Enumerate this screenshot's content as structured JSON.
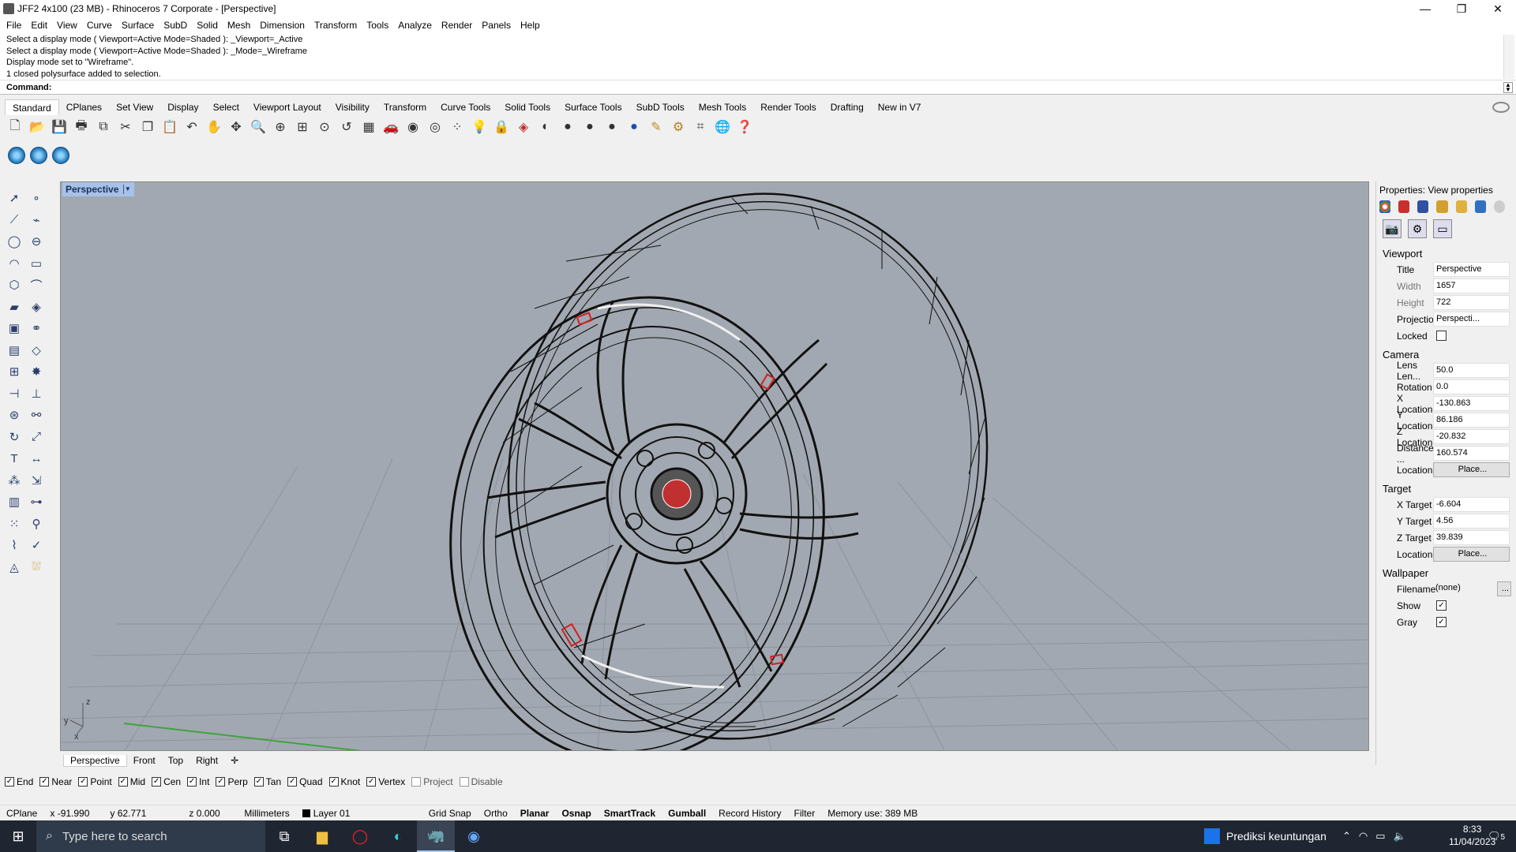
{
  "window": {
    "title": "JFF2 4x100 (23 MB) - Rhinoceros 7 Corporate - [Perspective]",
    "controls": [
      "—",
      "❐",
      "✕"
    ]
  },
  "menu": [
    "File",
    "Edit",
    "View",
    "Curve",
    "Surface",
    "SubD",
    "Solid",
    "Mesh",
    "Dimension",
    "Transform",
    "Tools",
    "Analyze",
    "Render",
    "Panels",
    "Help"
  ],
  "command_history": [
    "Select a display mode ( Viewport=Active  Mode=Shaded ): _Viewport=_Active",
    "Select a display mode ( Viewport=Active  Mode=Shaded ): _Mode=_Wireframe",
    "Display mode set to \"Wireframe\".",
    "1 closed polysurface added to selection."
  ],
  "command_prompt": "Command:",
  "toolbar_tabs": [
    "Standard",
    "CPlanes",
    "Set View",
    "Display",
    "Select",
    "Viewport Layout",
    "Visibility",
    "Transform",
    "Curve Tools",
    "Solid Tools",
    "Surface Tools",
    "SubD Tools",
    "Mesh Tools",
    "Render Tools",
    "Drafting",
    "New in V7"
  ],
  "toolbar_icons": [
    "new-file-icon",
    "open-icon",
    "save-icon",
    "print-icon",
    "import-icon",
    "cut-icon",
    "copy-icon",
    "paste-icon",
    "undo-icon",
    "pan-icon",
    "rotate-view-icon",
    "zoom-icon",
    "zoom-window-icon",
    "zoom-extents-icon",
    "zoom-selected-icon",
    "undo-view-icon",
    "four-view-icon",
    "car-icon",
    "eye-icon",
    "target-icon",
    "points-icon",
    "light-icon",
    "lock-icon",
    "layer-icon",
    "color-wheel-icon",
    "sphere-icon",
    "material-sphere-icon",
    "render-sphere-icon",
    "sphere-blue-icon",
    "pencil-icon",
    "gear-icon",
    "grid-icon",
    "globe-icon",
    "help-icon"
  ],
  "viewport": {
    "label": "Perspective",
    "axis_labels": {
      "z": "z",
      "y": "y",
      "x": "x"
    }
  },
  "viewport_tabs": [
    "Perspective",
    "Front",
    "Top",
    "Right"
  ],
  "osnaps": [
    {
      "label": "End",
      "checked": true
    },
    {
      "label": "Near",
      "checked": true
    },
    {
      "label": "Point",
      "checked": true
    },
    {
      "label": "Mid",
      "checked": true
    },
    {
      "label": "Cen",
      "checked": true
    },
    {
      "label": "Int",
      "checked": true
    },
    {
      "label": "Perp",
      "checked": true
    },
    {
      "label": "Tan",
      "checked": true
    },
    {
      "label": "Quad",
      "checked": true
    },
    {
      "label": "Knot",
      "checked": true
    },
    {
      "label": "Vertex",
      "checked": true
    },
    {
      "label": "Project",
      "checked": false
    },
    {
      "label": "Disable",
      "checked": false
    }
  ],
  "status": {
    "cplane": "CPlane",
    "x": "x -91.990",
    "y": "y 62.771",
    "z": "z 0.000",
    "units": "Millimeters",
    "layer": "Layer 01",
    "grid_snap": "Grid Snap",
    "ortho": "Ortho",
    "planar": "Planar",
    "osnap": "Osnap",
    "smarttrack": "SmartTrack",
    "gumball": "Gumball",
    "record_history": "Record History",
    "filter": "Filter",
    "memory": "Memory use: 389 MB"
  },
  "properties": {
    "header": "Properties: View properties",
    "sections": {
      "viewport": "Viewport",
      "camera": "Camera",
      "target": "Target",
      "wallpaper": "Wallpaper"
    },
    "viewport_rows": [
      {
        "label": "Title",
        "value": "Perspective"
      },
      {
        "label": "Width",
        "value": "1657"
      },
      {
        "label": "Height",
        "value": "722"
      },
      {
        "label": "Projection",
        "value": "Perspecti..."
      },
      {
        "label": "Locked",
        "value": ""
      }
    ],
    "camera_rows": [
      {
        "label": "Lens Len...",
        "value": "50.0"
      },
      {
        "label": "Rotation",
        "value": "0.0"
      },
      {
        "label": "X Location",
        "value": "-130.863"
      },
      {
        "label": "Y Location",
        "value": "86.186"
      },
      {
        "label": "Z Location",
        "value": "-20.832"
      },
      {
        "label": "Distance ...",
        "value": "160.574"
      },
      {
        "label": "Location",
        "value": "Place..."
      }
    ],
    "target_rows": [
      {
        "label": "X Target",
        "value": "-6.604"
      },
      {
        "label": "Y Target",
        "value": "4.56"
      },
      {
        "label": "Z Target",
        "value": "39.839"
      },
      {
        "label": "Location",
        "value": "Place..."
      }
    ],
    "wallpaper_rows": [
      {
        "label": "Filename",
        "value": "(none)"
      },
      {
        "label": "Show",
        "value": ""
      },
      {
        "label": "Gray",
        "value": ""
      }
    ],
    "filename_more": "..."
  },
  "taskbar": {
    "search_placeholder": "Type here to search",
    "news": "Prediksi keuntungan",
    "time": "8:33",
    "date": "11/04/2023",
    "notifications": "5"
  }
}
